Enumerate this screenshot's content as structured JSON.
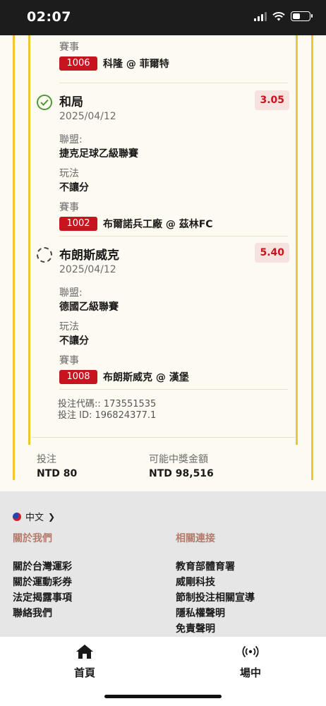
{
  "status_bar": {
    "time": "02:07"
  },
  "selections": [
    {
      "match_label": "賽事",
      "match_code": "1006",
      "match_name": "科隆 @ 菲爾特"
    },
    {
      "status": "won",
      "title": "和局",
      "date": "2025/04/12",
      "odds": "3.05",
      "league_label": "聯盟:",
      "league": "捷克足球乙級聯賽",
      "play_label": "玩法",
      "play": "不讓分",
      "match_label": "賽事",
      "match_code": "1002",
      "match_name": "布爾諾兵工廠 @ 茲林FC"
    },
    {
      "status": "pending",
      "title": "布朗斯威克",
      "date": "2025/04/12",
      "odds": "5.40",
      "league_label": "聯盟:",
      "league": "德國乙級聯賽",
      "play_label": "玩法",
      "play": "不讓分",
      "match_label": "賽事",
      "match_code": "1008",
      "match_name": "布朗斯威克 @ 漢堡"
    }
  ],
  "bet_info": {
    "code_line": "投注代碼:: 173551535",
    "id_line": "投注 ID: 196824377.1"
  },
  "totals": {
    "stake_label": "投注",
    "stake_value": "NTD 80",
    "payout_label": "可能中獎金額",
    "payout_value": "NTD 98,516"
  },
  "footer": {
    "language": "中文",
    "about_heading": "關於我們",
    "about_links": [
      "關於台灣運彩",
      "關於運動彩券",
      "法定揭露事項",
      "聯絡我們"
    ],
    "related_heading": "相關連接",
    "related_links": [
      "教育部體育署",
      "威剛科技",
      "節制投注相關宣導",
      "隱私權聲明",
      "免責聲明"
    ]
  },
  "bottom_nav": {
    "home_label": "首頁",
    "live_label": "場中"
  },
  "colors": {
    "accent_yellow": "#f0c432",
    "badge_red": "#c8141e",
    "won_green": "#4e9a36",
    "odds_bg": "#f6e2de"
  }
}
